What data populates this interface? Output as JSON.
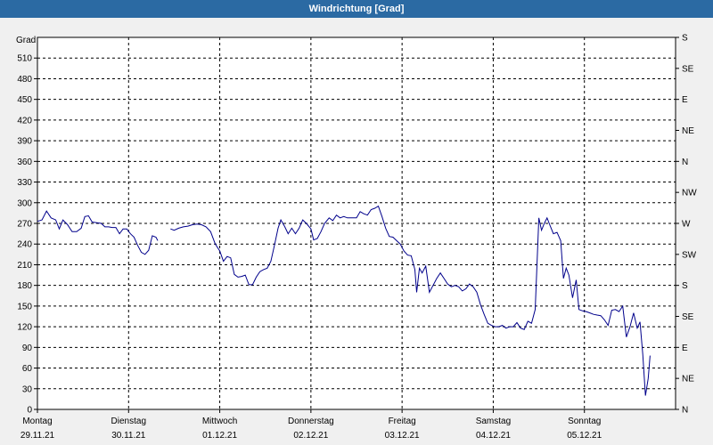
{
  "window": {
    "title": "Windrichtung [Grad]"
  },
  "chart_data": {
    "type": "line",
    "title": "Windrichtung [Grad]",
    "ylabel": "Grad",
    "ylim": [
      0,
      540
    ],
    "yticks": [
      0,
      30,
      60,
      90,
      120,
      150,
      180,
      210,
      240,
      270,
      300,
      330,
      360,
      390,
      420,
      450,
      480,
      510
    ],
    "right_axis_labels": [
      "N",
      "NE",
      "E",
      "SE",
      "S",
      "SW",
      "W",
      "NW",
      "N",
      "NE",
      "E",
      "SE",
      "S"
    ],
    "x_labels": [
      {
        "day": "Montag",
        "date": "29.11.21"
      },
      {
        "day": "Dienstag",
        "date": "30.11.21"
      },
      {
        "day": "Mittwoch",
        "date": "01.12.21"
      },
      {
        "day": "Donnerstag",
        "date": "02.12.21"
      },
      {
        "day": "Freitag",
        "date": "03.12.21"
      },
      {
        "day": "Samstag",
        "date": "04.12.21"
      },
      {
        "day": "Sonntag",
        "date": "05.12.21"
      }
    ],
    "x_unit": "days since Montag 29.11.21 00:00",
    "xlim": [
      0,
      7
    ],
    "grid": true,
    "line_color": "#00008b",
    "series": [
      {
        "segments": [
          [
            [
              0.0,
              273
            ],
            [
              0.05,
              275
            ],
            [
              0.1,
              288
            ],
            [
              0.15,
              278
            ],
            [
              0.2,
              275
            ],
            [
              0.24,
              262
            ],
            [
              0.28,
              275
            ],
            [
              0.33,
              268
            ],
            [
              0.38,
              258
            ],
            [
              0.43,
              258
            ],
            [
              0.48,
              263
            ],
            [
              0.52,
              280
            ],
            [
              0.56,
              281
            ],
            [
              0.6,
              272
            ],
            [
              0.65,
              271
            ],
            [
              0.7,
              270
            ],
            [
              0.74,
              265
            ],
            [
              0.78,
              265
            ],
            [
              0.82,
              264
            ],
            [
              0.86,
              264
            ],
            [
              0.9,
              255
            ],
            [
              0.94,
              262
            ],
            [
              0.98,
              262
            ],
            [
              1.02,
              255
            ],
            [
              1.06,
              250
            ],
            [
              1.1,
              238
            ],
            [
              1.14,
              228
            ],
            [
              1.18,
              225
            ],
            [
              1.22,
              231
            ],
            [
              1.26,
              252
            ],
            [
              1.3,
              250
            ],
            [
              1.32,
              245
            ]
          ],
          [
            [
              1.46,
              262
            ],
            [
              1.5,
              260
            ],
            [
              1.55,
              263
            ],
            [
              1.6,
              265
            ],
            [
              1.65,
              266
            ],
            [
              1.7,
              268
            ],
            [
              1.75,
              269
            ],
            [
              1.8,
              268
            ],
            [
              1.85,
              265
            ],
            [
              1.9,
              258
            ],
            [
              1.95,
              240
            ],
            [
              2.0,
              230
            ],
            [
              2.04,
              215
            ],
            [
              2.08,
              222
            ],
            [
              2.12,
              220
            ],
            [
              2.16,
              196
            ],
            [
              2.2,
              192
            ],
            [
              2.24,
              193
            ],
            [
              2.28,
              195
            ],
            [
              2.32,
              181
            ],
            [
              2.36,
              181
            ],
            [
              2.4,
              192
            ],
            [
              2.44,
              200
            ],
            [
              2.48,
              203
            ],
            [
              2.52,
              205
            ],
            [
              2.56,
              215
            ],
            [
              2.6,
              238
            ],
            [
              2.64,
              263
            ],
            [
              2.67,
              275
            ],
            [
              2.71,
              266
            ],
            [
              2.75,
              255
            ],
            [
              2.79,
              263
            ],
            [
              2.83,
              255
            ],
            [
              2.87,
              263
            ],
            [
              2.91,
              275
            ],
            [
              2.95,
              270
            ],
            [
              3.0,
              262
            ],
            [
              3.03,
              246
            ],
            [
              3.07,
              248
            ],
            [
              3.11,
              258
            ],
            [
              3.15,
              270
            ],
            [
              3.2,
              278
            ],
            [
              3.24,
              274
            ],
            [
              3.28,
              282
            ],
            [
              3.32,
              278
            ],
            [
              3.36,
              280
            ],
            [
              3.4,
              278
            ],
            [
              3.45,
              278
            ],
            [
              3.5,
              278
            ],
            [
              3.54,
              287
            ],
            [
              3.58,
              284
            ],
            [
              3.62,
              282
            ],
            [
              3.66,
              290
            ],
            [
              3.7,
              292
            ],
            [
              3.74,
              295
            ],
            [
              3.78,
              280
            ],
            [
              3.82,
              263
            ],
            [
              3.86,
              251
            ],
            [
              3.9,
              250
            ],
            [
              3.94,
              245
            ],
            [
              3.98,
              240
            ],
            [
              4.02,
              230
            ],
            [
              4.06,
              224
            ],
            [
              4.1,
              223
            ],
            [
              4.14,
              203
            ],
            [
              4.16,
              170
            ],
            [
              4.19,
              205
            ],
            [
              4.22,
              198
            ],
            [
              4.26,
              208
            ],
            [
              4.3,
              170
            ],
            [
              4.34,
              180
            ],
            [
              4.38,
              190
            ],
            [
              4.42,
              198
            ],
            [
              4.46,
              190
            ],
            [
              4.5,
              182
            ],
            [
              4.54,
              178
            ],
            [
              4.58,
              180
            ],
            [
              4.62,
              178
            ],
            [
              4.66,
              172
            ],
            [
              4.7,
              175
            ],
            [
              4.74,
              182
            ],
            [
              4.78,
              178
            ],
            [
              4.82,
              170
            ],
            [
              4.86,
              152
            ],
            [
              4.9,
              138
            ],
            [
              4.94,
              125
            ],
            [
              4.98,
              122
            ],
            [
              5.02,
              120
            ],
            [
              5.06,
              120
            ],
            [
              5.1,
              122
            ],
            [
              5.14,
              118
            ],
            [
              5.18,
              120
            ],
            [
              5.22,
              120
            ],
            [
              5.26,
              126
            ],
            [
              5.3,
              118
            ],
            [
              5.34,
              116
            ],
            [
              5.38,
              128
            ],
            [
              5.42,
              125
            ],
            [
              5.46,
              145
            ],
            [
              5.5,
              278
            ],
            [
              5.53,
              260
            ],
            [
              5.56,
              270
            ],
            [
              5.59,
              278
            ],
            [
              5.62,
              268
            ],
            [
              5.66,
              255
            ],
            [
              5.7,
              257
            ],
            [
              5.74,
              245
            ],
            [
              5.77,
              190
            ],
            [
              5.8,
              205
            ],
            [
              5.83,
              195
            ],
            [
              5.87,
              162
            ],
            [
              5.91,
              188
            ],
            [
              5.94,
              145
            ],
            [
              5.98,
              143
            ],
            [
              6.02,
              142
            ],
            [
              6.06,
              140
            ],
            [
              6.1,
              138
            ],
            [
              6.14,
              137
            ],
            [
              6.18,
              136
            ],
            [
              6.22,
              130
            ],
            [
              6.26,
              122
            ],
            [
              6.3,
              144
            ],
            [
              6.34,
              145
            ],
            [
              6.38,
              142
            ],
            [
              6.42,
              150
            ],
            [
              6.46,
              105
            ],
            [
              6.5,
              120
            ],
            [
              6.54,
              140
            ],
            [
              6.58,
              118
            ],
            [
              6.61,
              127
            ],
            [
              6.64,
              80
            ],
            [
              6.67,
              20
            ],
            [
              6.7,
              45
            ],
            [
              6.72,
              78
            ]
          ]
        ]
      }
    ]
  }
}
